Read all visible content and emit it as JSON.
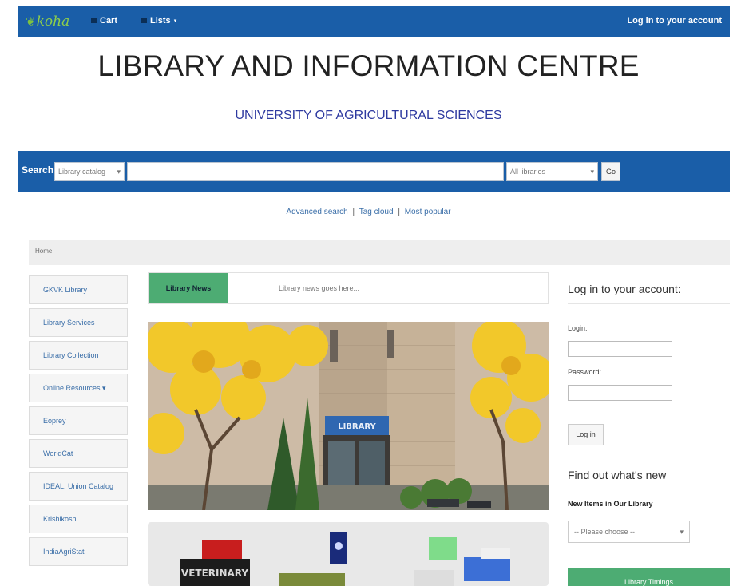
{
  "navbar": {
    "logo": "koha",
    "cart": "Cart",
    "lists": "Lists",
    "login": "Log in to your account"
  },
  "header": {
    "title": "LIBRARY AND INFORMATION CENTRE",
    "subtitle": "UNIVERSITY OF AGRICULTURAL SCIENCES"
  },
  "search": {
    "label": "Search",
    "catalog_select": "Library catalog",
    "query_value": "",
    "libraries_select": "All libraries",
    "go": "Go"
  },
  "search_links": {
    "advanced": "Advanced search",
    "tag_cloud": "Tag cloud",
    "most_popular": "Most popular",
    "separator": "|"
  },
  "breadcrumb": {
    "home": "Home"
  },
  "sidebar": {
    "items": [
      {
        "label": "GKVK Library"
      },
      {
        "label": "Library Services"
      },
      {
        "label": "Library Collection"
      },
      {
        "label": "Online Resources ▾"
      },
      {
        "label": "Eoprey"
      },
      {
        "label": "WorldCat"
      },
      {
        "label": "IDEAL: Union Catalog"
      },
      {
        "label": "Krishikosh"
      },
      {
        "label": "IndiaAgriStat"
      }
    ]
  },
  "news": {
    "tab": "Library News",
    "text": "Library news goes here..."
  },
  "photo": {
    "sign": "LIBRARY"
  },
  "featured": {
    "book1": "VETERINARY"
  },
  "login": {
    "heading": "Log in to your account:",
    "login_label": "Login:",
    "login_value": "",
    "password_label": "Password:",
    "password_value": "",
    "button": "Log in"
  },
  "whats_new": {
    "heading": "Find out what's new",
    "new_items_label": "New Items in Our Library",
    "select": "-- Please choose --"
  },
  "timings_button": "Library Timings",
  "colors": {
    "brand_blue": "#1a5ea8",
    "accent_green": "#4dac73",
    "koha_green": "#8fcf4a"
  }
}
